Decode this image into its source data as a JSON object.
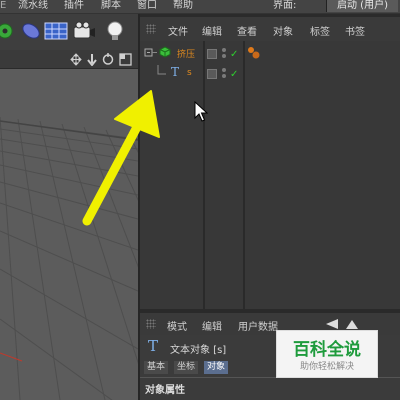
{
  "menu": {
    "items": [
      "流水线",
      "插件",
      "脚本",
      "窗口",
      "帮助"
    ],
    "edge_item": "E",
    "layout_label": "界面:",
    "layout_value": "启动 (用户)"
  },
  "object_manager": {
    "tabs": [
      "文件",
      "编辑",
      "查看",
      "对象",
      "标签",
      "书签"
    ],
    "objects": [
      {
        "name": "挤压",
        "icon": "extrude-icon"
      },
      {
        "name": "s",
        "icon": "text-spline-icon"
      }
    ]
  },
  "attribute_manager": {
    "tabs": [
      "模式",
      "编辑",
      "用户数据"
    ],
    "object_title": "文本对象 [s]",
    "subtabs": [
      "基本",
      "坐标",
      "对象"
    ],
    "active_subtab": "对象",
    "section_title": "对象属性"
  },
  "watermark": {
    "title": "百科全说",
    "subtitle": "助你轻松解决"
  },
  "colors": {
    "arrow": "#f0f000",
    "accent_orange": "#e08a1e",
    "check_green": "#2fcf2f"
  }
}
